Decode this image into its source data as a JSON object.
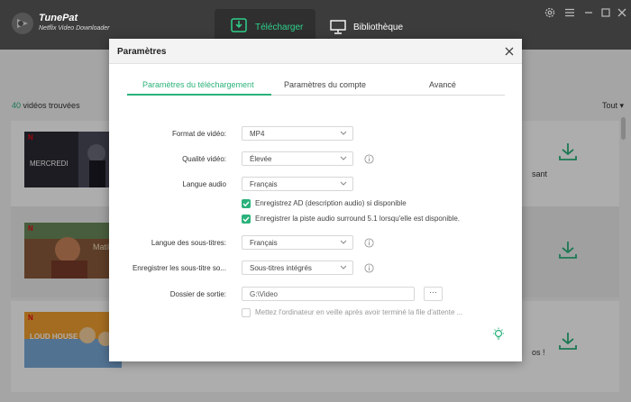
{
  "app": {
    "name": "TunePat",
    "subtitle": "Netflix Video Downloader",
    "accent": "#2ab27b"
  },
  "nav": {
    "download_label": "Télécharger",
    "library_label": "Bibliothèque"
  },
  "window_controls": [
    "gear-icon",
    "menu-icon",
    "minimize-icon",
    "maximize-icon",
    "close-icon"
  ],
  "list": {
    "count_num": "40",
    "count_text": "vidéos trouvées",
    "filter_label": "Tout",
    "items": [
      {
        "title_art": "MERCREDI",
        "visible_text": "sant"
      },
      {
        "title_art": "Matil",
        "visible_text": ""
      },
      {
        "title_art": "LOUD HOUSE",
        "visible_text": "os !"
      }
    ]
  },
  "dialog": {
    "title": "Paramètres",
    "tabs": [
      {
        "label": "Paramètres du téléchargement",
        "active": true
      },
      {
        "label": "Paramètres du compte",
        "active": false
      },
      {
        "label": "Avancé",
        "active": false
      }
    ],
    "fields": {
      "video_format": {
        "label": "Format de vidéo:",
        "value": "MP4"
      },
      "video_quality": {
        "label": "Qualité vidéo:",
        "value": "Élevée"
      },
      "audio_language": {
        "label": "Langue audio",
        "value": "Français"
      },
      "ad_checkbox": {
        "label": "Enregistrez AD (description audio) si disponible",
        "checked": true
      },
      "surround_checkbox": {
        "label": "Enregistrer la piste audio surround 5.1 lorsqu'elle est disponible.",
        "checked": true
      },
      "subtitle_language": {
        "label": "Langue des sous-titres:",
        "value": "Français"
      },
      "subtitle_save": {
        "label": "Enregistrer les sous-titre so...",
        "value": "Sous-titres intégrés"
      },
      "output_folder": {
        "label": "Dossier de sortie:",
        "value": "G:\\Video",
        "browse_label": "···"
      },
      "sleep_checkbox": {
        "label": "Mettez l'ordinateur en veille après avoir terminé la file d'attente ...",
        "checked": false
      }
    }
  }
}
